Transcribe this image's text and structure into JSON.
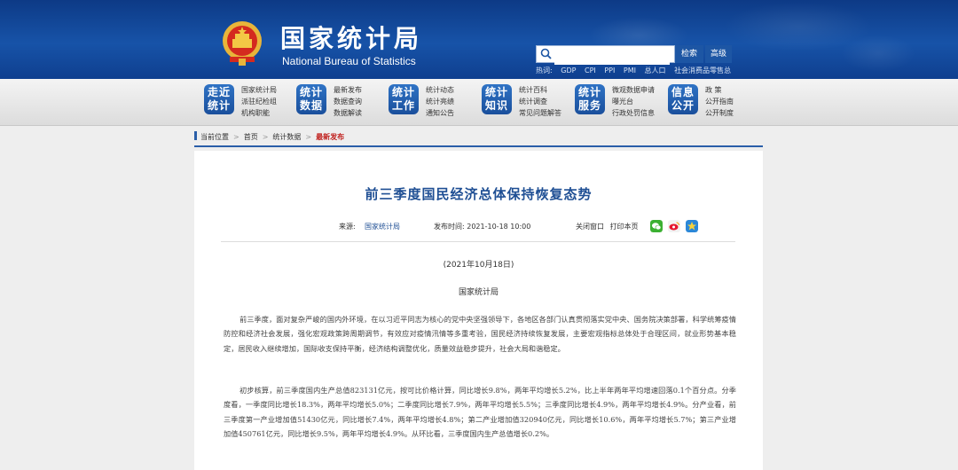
{
  "header": {
    "org_cn": "国家统计局",
    "org_en": "National Bureau of Statistics",
    "search": {
      "placeholder": "",
      "search_label": "检索",
      "advanced_label": "高级"
    },
    "hot_label": "热词:",
    "hot_terms": [
      "GDP",
      "CPI",
      "PPI",
      "PMI",
      "总人口",
      "社会消费品零售总"
    ]
  },
  "nav": [
    {
      "badge": "走近统计",
      "links": [
        "国家统计局",
        "派驻纪检组",
        "机构职能"
      ]
    },
    {
      "badge": "统计数据",
      "links": [
        "最新发布",
        "数据查询",
        "数据解读"
      ]
    },
    {
      "badge": "统计工作",
      "links": [
        "统计动态",
        "统计亮绩",
        "通知公告"
      ]
    },
    {
      "badge": "统计知识",
      "links": [
        "统计百科",
        "统计调查",
        "常见问题解答"
      ]
    },
    {
      "badge": "统计服务",
      "links": [
        "微观数据申请",
        "曝光台",
        "行政处罚信息"
      ]
    },
    {
      "badge": "信息公开",
      "links": [
        "政 策",
        "公开指南",
        "公开制度"
      ]
    }
  ],
  "breadcrumb": {
    "current_position": "当前位置",
    "items": [
      "首页",
      "统计数据"
    ],
    "current": "最新发布"
  },
  "article": {
    "title": "前三季度国民经济总体保持恢复态势",
    "source_label": "来源:",
    "source": "国家统计局",
    "time_label": "发布时间:",
    "time": "2021-10-18 10:00",
    "close_label": "关闭窗口",
    "print_label": "打印本页",
    "date": "(2021年10月18日)",
    "author": "国家统计局",
    "paragraphs": [
      "前三季度，面对复杂严峻的国内外环境，在以习近平同志为核心的党中央坚强领导下，各地区各部门认真贯彻落实党中央、国务院决策部署，科学统筹疫情防控和经济社会发展，强化宏观政策跨周期调节，有效应对疫情汛情等多重考验，国民经济持续恢复发展，主要宏观指标总体处于合理区间，就业形势基本稳定，居民收入继续增加，国际收支保持平衡，经济结构调整优化，质量效益稳步提升，社会大局和谐稳定。",
      "初步核算，前三季度国内生产总值823131亿元，按可比价格计算，同比增长9.8%，两年平均增长5.2%，比上半年两年平均增速回落0.1个百分点。分季度看，一季度同比增长18.3%，两年平均增长5.0%；二季度同比增长7.9%，两年平均增长5.5%；三季度同比增长4.9%，两年平均增长4.9%。分产业看，前三季度第一产业增加值51430亿元，同比增长7.4%，两年平均增长4.8%；第二产业增加值320940亿元，同比增长10.6%，两年平均增长5.7%；第三产业增加值450761亿元，同比增长9.5%，两年平均增长4.9%。从环比看，三季度国内生产总值增长0.2%。"
    ]
  },
  "colors": {
    "header_blue": "#1753a8",
    "title_blue": "#1f4f94",
    "crumb_red": "#c0211e"
  }
}
